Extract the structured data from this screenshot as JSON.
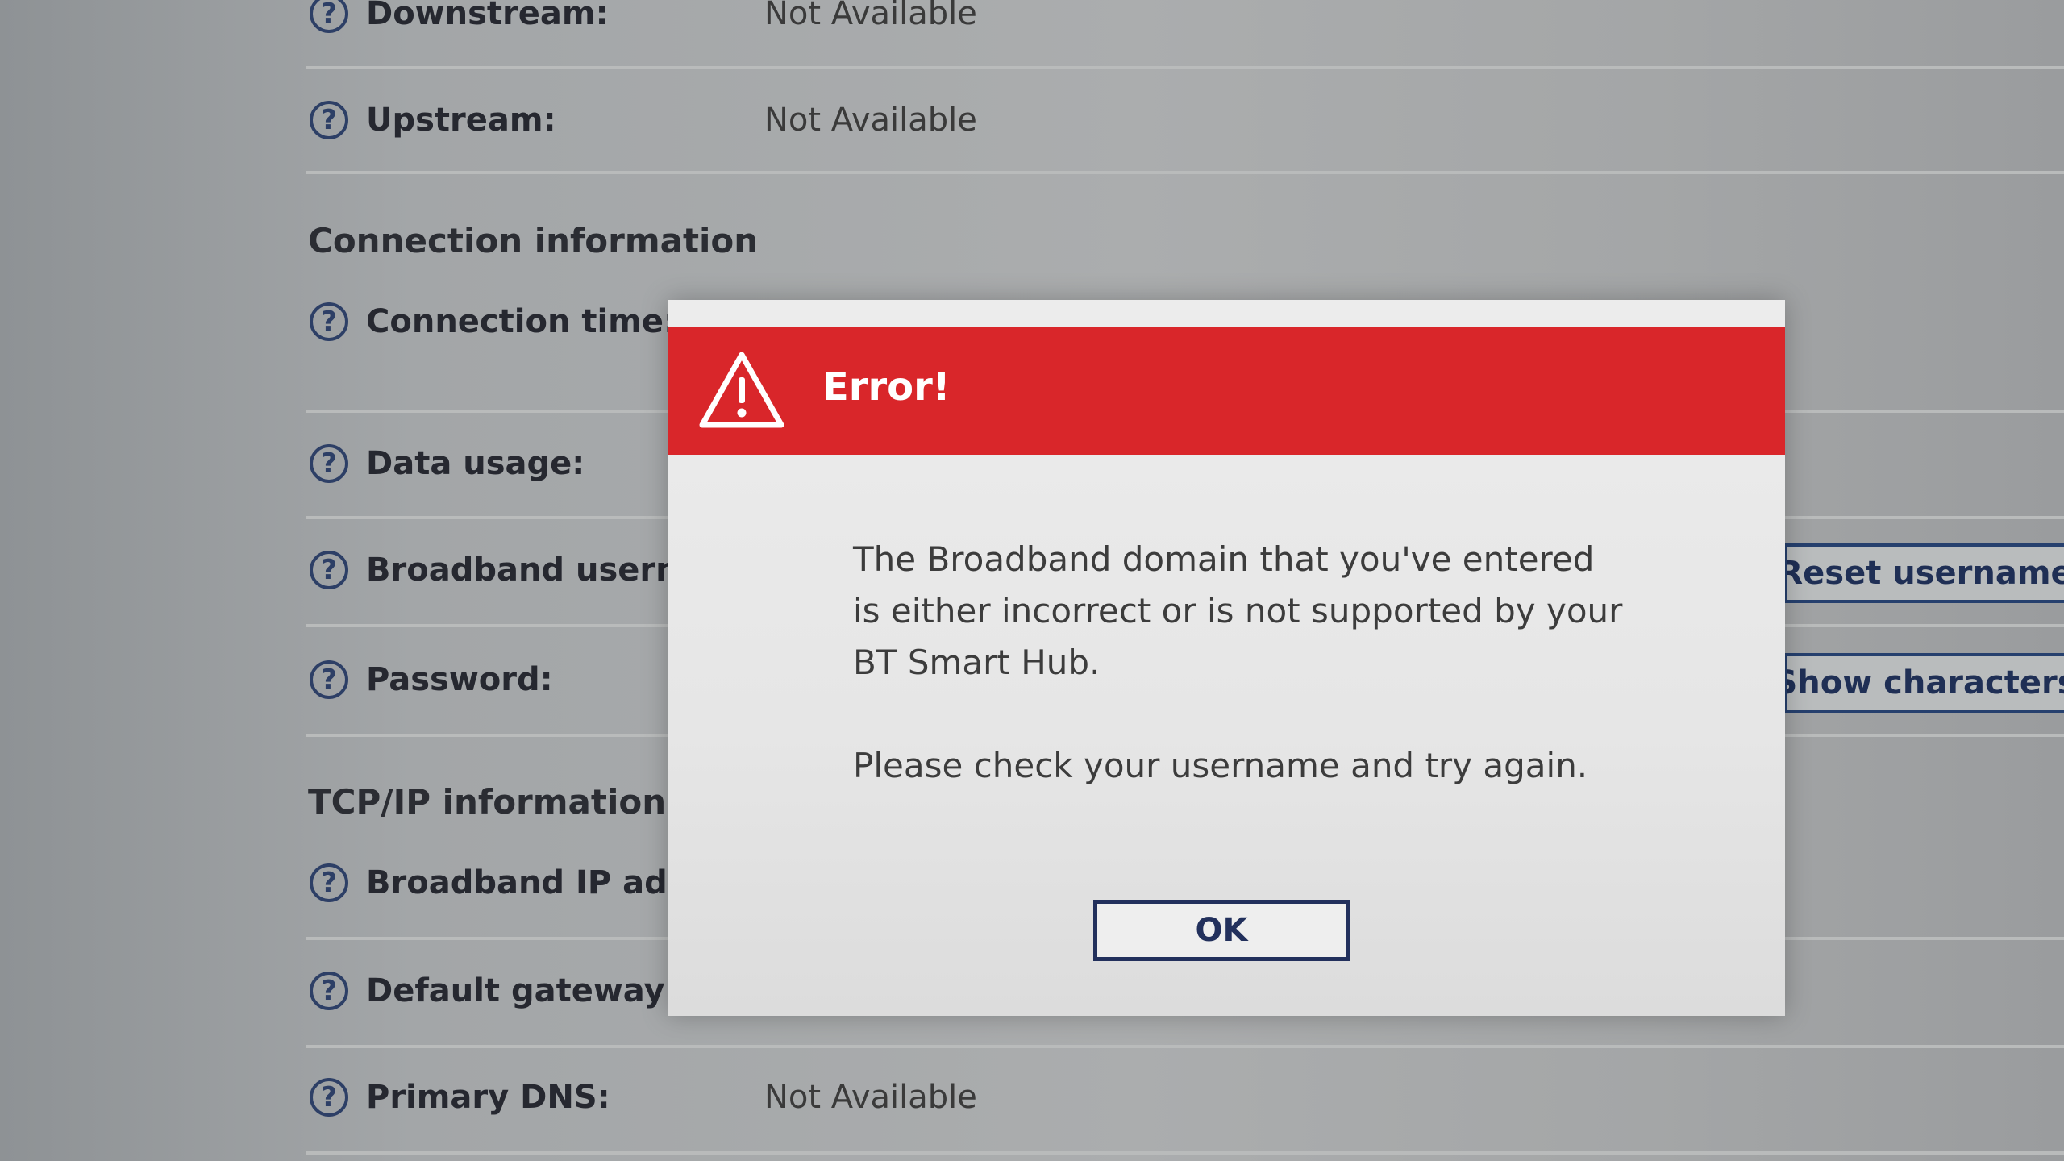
{
  "background": {
    "rows": [
      {
        "label": "Downstream:",
        "value": "Not Available"
      },
      {
        "label": "Upstream:",
        "value": "Not Available"
      },
      {
        "label": "Connection time:",
        "value": ""
      },
      {
        "label": "Data usage:",
        "value": ""
      },
      {
        "label": "Broadband usernam",
        "value": ""
      },
      {
        "label": "Password:",
        "value": ""
      },
      {
        "label": "Broadband IP addre",
        "value": ""
      },
      {
        "label": "Default gateway:",
        "value": ""
      },
      {
        "label": "Primary DNS:",
        "value": "Not Available"
      }
    ],
    "sections": {
      "connection_information": "Connection information",
      "tcpip_information": "TCP/IP information"
    },
    "buttons": {
      "reset_username": "Reset username",
      "show_characters": "Show characters"
    },
    "help_glyph": "?"
  },
  "dialog": {
    "title": "Error!",
    "message_line1": "The Broadband domain that you've entered is either incorrect or is not supported by your BT Smart Hub.",
    "message_line2": "Please check your username and try again.",
    "ok_label": "OK",
    "header_color": "#d9262a",
    "icon": "warning-triangle-icon"
  }
}
